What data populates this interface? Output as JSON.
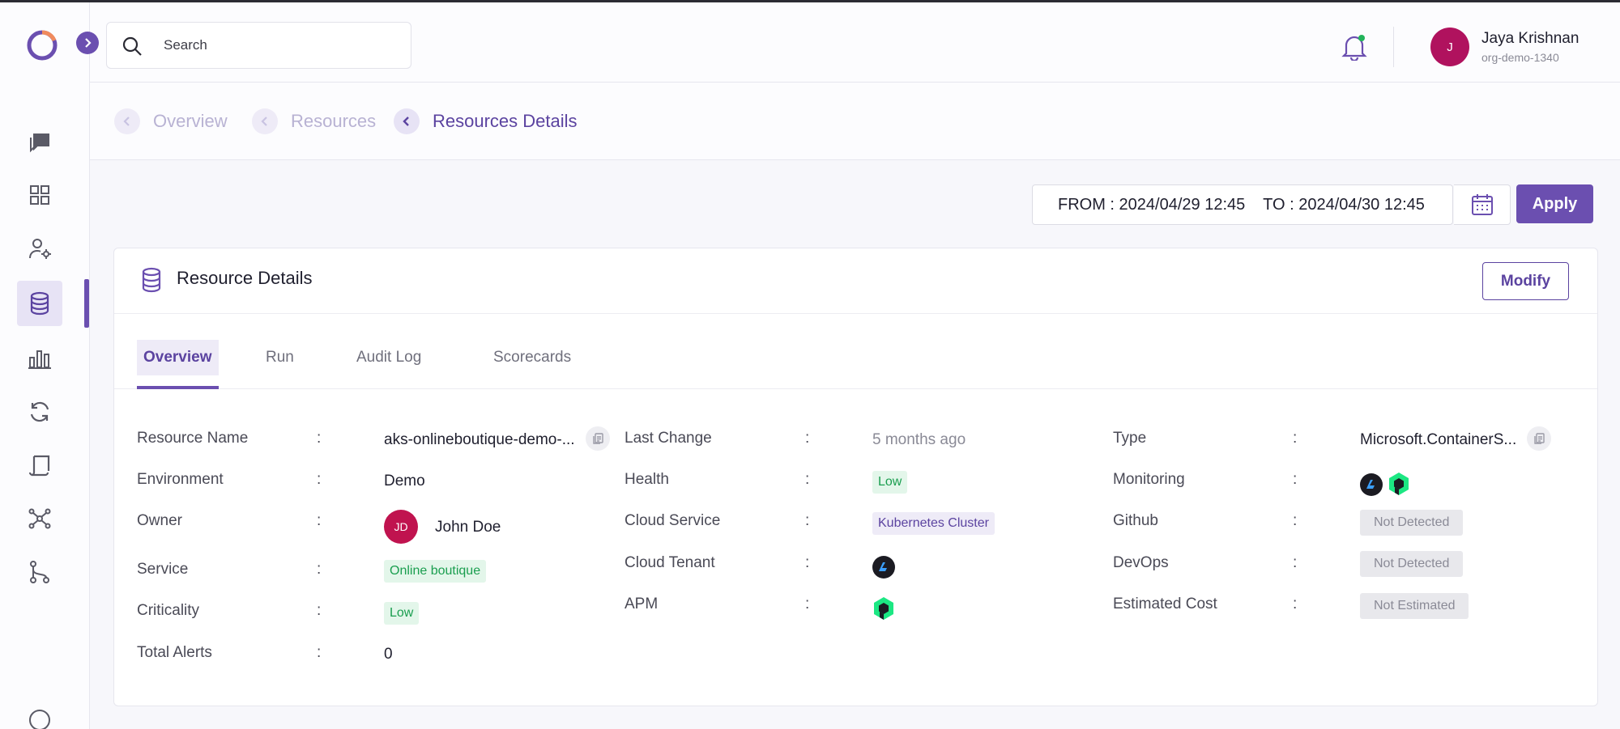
{
  "search": {
    "placeholder": "Search"
  },
  "user": {
    "initial": "J",
    "name": "Jaya Krishnan",
    "org": "org-demo-1340"
  },
  "breadcrumb": [
    {
      "label": "Overview"
    },
    {
      "label": "Resources"
    },
    {
      "label": "Resources Details"
    }
  ],
  "date_range": {
    "text": "FROM : 2024/04/29 12:45    TO : 2024/04/30 12:45"
  },
  "apply_label": "Apply",
  "card": {
    "title": "Resource Details",
    "modify_label": "Modify",
    "tabs": [
      {
        "label": "Overview"
      },
      {
        "label": "Run"
      },
      {
        "label": "Audit Log"
      },
      {
        "label": "Scorecards"
      }
    ]
  },
  "sep": ":",
  "fields": {
    "resource_name": {
      "label": "Resource Name",
      "value": "aks-onlineboutique-demo-..."
    },
    "environment": {
      "label": "Environment",
      "value": "Demo"
    },
    "owner": {
      "label": "Owner",
      "initials": "JD",
      "value": "John Doe"
    },
    "service": {
      "label": "Service",
      "value": "Online boutique"
    },
    "criticality": {
      "label": "Criticality",
      "value": "Low"
    },
    "total_alerts": {
      "label": "Total Alerts",
      "value": "0"
    },
    "last_change": {
      "label": "Last Change",
      "value": "5 months ago"
    },
    "health": {
      "label": "Health",
      "value": "Low"
    },
    "cloud_service": {
      "label": "Cloud Service",
      "value": "Kubernetes Cluster"
    },
    "cloud_tenant": {
      "label": "Cloud Tenant",
      "icon": "azure-icon"
    },
    "apm": {
      "label": "APM",
      "icon": "new-relic-icon"
    },
    "type": {
      "label": "Type",
      "value": "Microsoft.ContainerS..."
    },
    "monitoring": {
      "label": "Monitoring",
      "icons": [
        "azure-icon",
        "new-relic-icon"
      ]
    },
    "github": {
      "label": "Github",
      "value": "Not Detected"
    },
    "devops": {
      "label": "DevOps",
      "value": "Not Detected"
    },
    "estimated_cost": {
      "label": "Estimated Cost",
      "value": "Not Estimated"
    }
  },
  "colors": {
    "accent": "#6b4fb0",
    "success_bg": "#e3f6ea",
    "success_text": "#1a9e4f",
    "avatar": "#b0125e"
  }
}
